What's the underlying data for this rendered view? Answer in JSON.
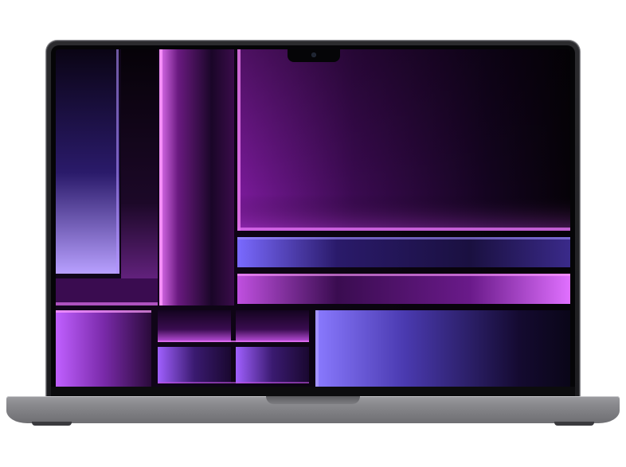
{
  "device": {
    "kind": "laptop",
    "finish": "space-gray",
    "colors": {
      "body": "#8a8a8e",
      "bezel": "#050507",
      "wallpaper_magenta": "#c040e0",
      "wallpaper_violet": "#6a4cff",
      "wallpaper_deep": "#12061c"
    }
  },
  "wallpaper": {
    "style": "abstract-glowing-panels",
    "dominant_colors": [
      "#c040e0",
      "#6a4cff",
      "#12061c"
    ]
  }
}
